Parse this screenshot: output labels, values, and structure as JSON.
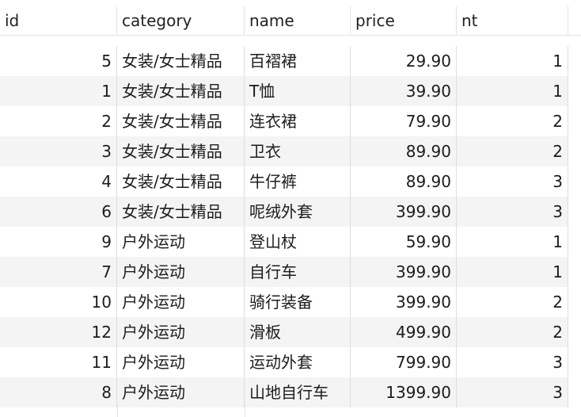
{
  "columns": {
    "id": "id",
    "category": "category",
    "name": "name",
    "price": "price",
    "nt": "nt"
  },
  "rows": [
    {
      "id": "5",
      "category": "女装/女士精品",
      "name": "百褶裙",
      "price": "29.90",
      "nt": "1"
    },
    {
      "id": "1",
      "category": "女装/女士精品",
      "name": "T恤",
      "price": "39.90",
      "nt": "1"
    },
    {
      "id": "2",
      "category": "女装/女士精品",
      "name": "连衣裙",
      "price": "79.90",
      "nt": "2"
    },
    {
      "id": "3",
      "category": "女装/女士精品",
      "name": "卫衣",
      "price": "89.90",
      "nt": "2"
    },
    {
      "id": "4",
      "category": "女装/女士精品",
      "name": "牛仔裤",
      "price": "89.90",
      "nt": "3"
    },
    {
      "id": "6",
      "category": "女装/女士精品",
      "name": "呢绒外套",
      "price": "399.90",
      "nt": "3"
    },
    {
      "id": "9",
      "category": "户外运动",
      "name": "登山杖",
      "price": "59.90",
      "nt": "1"
    },
    {
      "id": "7",
      "category": "户外运动",
      "name": "自行车",
      "price": "399.90",
      "nt": "1"
    },
    {
      "id": "10",
      "category": "户外运动",
      "name": "骑行装备",
      "price": "399.90",
      "nt": "2"
    },
    {
      "id": "12",
      "category": "户外运动",
      "name": "滑板",
      "price": "499.90",
      "nt": "2"
    },
    {
      "id": "11",
      "category": "户外运动",
      "name": "运动外套",
      "price": "799.90",
      "nt": "3"
    },
    {
      "id": "8",
      "category": "户外运动",
      "name": "山地自行车",
      "price": "1399.90",
      "nt": "3"
    }
  ],
  "colors": {
    "row_alt": "#f4f4f4",
    "grid_line": "#dddddd"
  }
}
